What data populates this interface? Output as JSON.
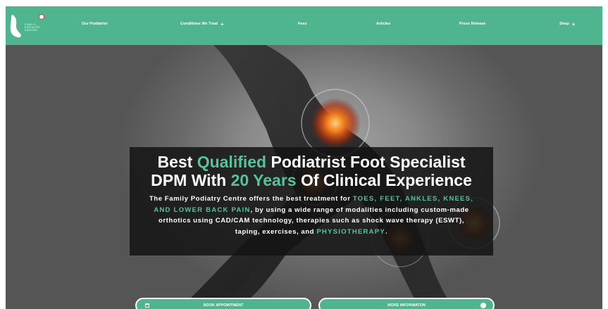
{
  "brand": {
    "logo_lines": [
      "Family",
      "Podiatry",
      "Centre"
    ],
    "icon": "foot-logo-icon"
  },
  "nav": {
    "items": [
      {
        "label": "Our Podiatrist",
        "has_submenu": false
      },
      {
        "label": "Conditions We Treat",
        "has_submenu": true
      },
      {
        "label": "Fees",
        "has_submenu": false
      },
      {
        "label": "Articles",
        "has_submenu": false
      },
      {
        "label": "Press Release",
        "has_submenu": false
      },
      {
        "label": "Shop",
        "has_submenu": true
      }
    ],
    "submenu_icon": "+"
  },
  "hero": {
    "headline": {
      "line1": {
        "pre": "Best ",
        "accent": "Qualified",
        "post": " Podiatrist Foot Specialist"
      },
      "line2": {
        "pre": "DPM With ",
        "accent": "20 Years",
        "post": " Of Clinical Experience"
      }
    },
    "paragraph": {
      "p1": "The Family Podiatry Centre offers the best treatment for ",
      "a1": "TOES, FEET, ANKLES, KNEES, AND LOWER BACK PAIN",
      "p2": ", by using a wide range of modalities including custom-made orthotics using CAD/CAM technology, therapies such as shock wave therapy (ESWT), taping, exercises, and ",
      "a2": "PHYSIOTHERAPY",
      "p3": "."
    },
    "buttons": {
      "book": "BOOK APPOINTMENT",
      "more": "MORE INFORMATON"
    }
  },
  "colors": {
    "accent": "#4fb58e",
    "accent_text": "#56c39a",
    "panel": "#141414"
  }
}
